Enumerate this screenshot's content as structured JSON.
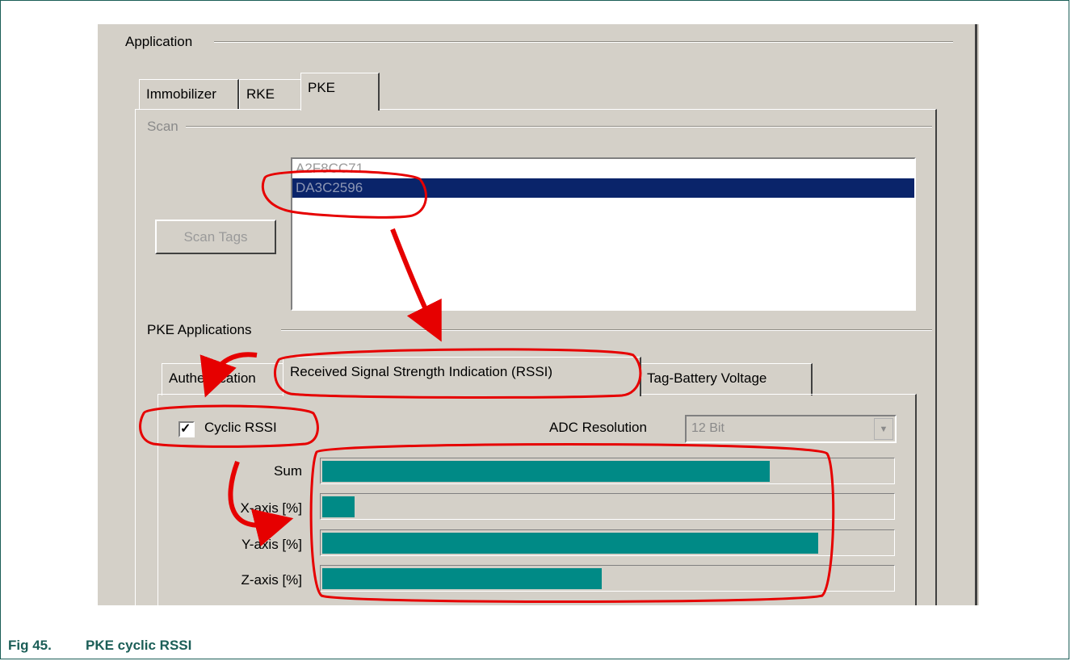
{
  "application_group": {
    "label": "Application"
  },
  "tabs": [
    {
      "label": "Immobilizer"
    },
    {
      "label": "RKE"
    },
    {
      "label": "PKE"
    }
  ],
  "scan_group": {
    "label": "Scan"
  },
  "scan_button": {
    "label": "Scan Tags"
  },
  "tag_list": [
    {
      "label": "A2F8CC71"
    },
    {
      "label": "DA3C2596"
    }
  ],
  "pke_applications": {
    "label": "PKE Applications",
    "tabs": [
      {
        "label": "Authentication"
      },
      {
        "label": "Received Signal Strength Indication (RSSI)"
      },
      {
        "label": "Tag-Battery Voltage"
      }
    ]
  },
  "cyclic_rssi": {
    "label": "Cyclic RSSI",
    "checked": true
  },
  "adc_resolution": {
    "label": "ADC Resolution",
    "value": "12 Bit"
  },
  "bars": [
    {
      "label": "Sum",
      "level": 0.785
    },
    {
      "label": "X-axis [%]",
      "level": 0.056
    },
    {
      "label": "Y-axis [%]",
      "level": 0.87
    },
    {
      "label": "Z-axis [%]",
      "level": 0.49
    }
  ],
  "colors": {
    "bar_fill": "#008a86",
    "annotation": "#e60000",
    "caption": "#1b5e57",
    "selection": "#0a246a"
  },
  "caption": {
    "number": "Fig 45.",
    "text": "PKE cyclic RSSI"
  }
}
